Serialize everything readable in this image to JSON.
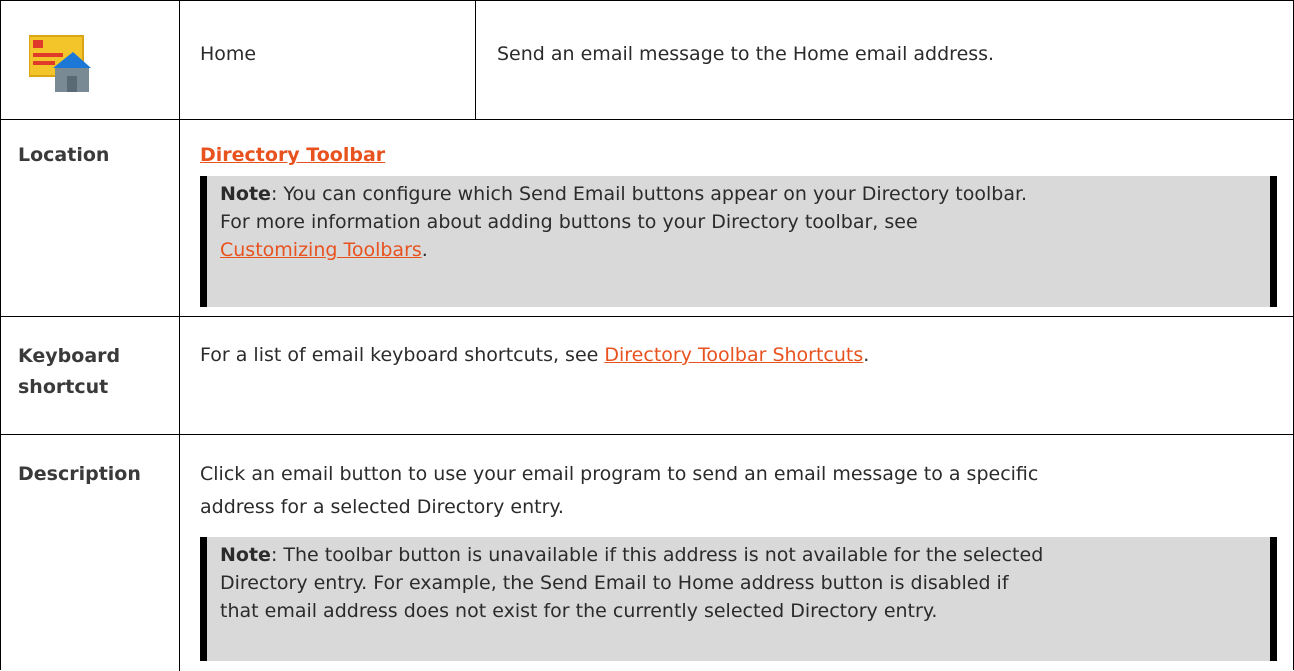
{
  "header_row": {
    "icon": "send-email-home-icon",
    "name": "Home",
    "summary": "Send an email message to the Home email address."
  },
  "location": {
    "label": "Location",
    "link": "Directory Toolbar",
    "note": {
      "prefix": "Note",
      "line1": ": You can configure which Send Email buttons appear on your Directory toolbar.",
      "line2": "For more information about adding buttons to your Directory toolbar, see",
      "link": "Customizing Toolbars",
      "suffix": "."
    }
  },
  "keyboard": {
    "label_line1": "Keyboard",
    "label_line2": "shortcut",
    "text": "For a list of email keyboard shortcuts, see ",
    "link": "Directory Toolbar Shortcuts",
    "suffix": "."
  },
  "description": {
    "label": "Description",
    "line1": "Click an email button to use your email program to send an email message to a specific",
    "line2": "address for a selected Directory entry.",
    "note": {
      "prefix": "Note",
      "line1": ": The toolbar button is unavailable if this address is not available for the selected",
      "line2": "Directory entry. For example, the Send Email to Home address button is disabled if",
      "line3": "that email address does not exist for the currently selected Directory entry."
    }
  },
  "colors": {
    "link": "#e8521f",
    "note_bg": "#d9d9d9",
    "border": "#000000"
  }
}
